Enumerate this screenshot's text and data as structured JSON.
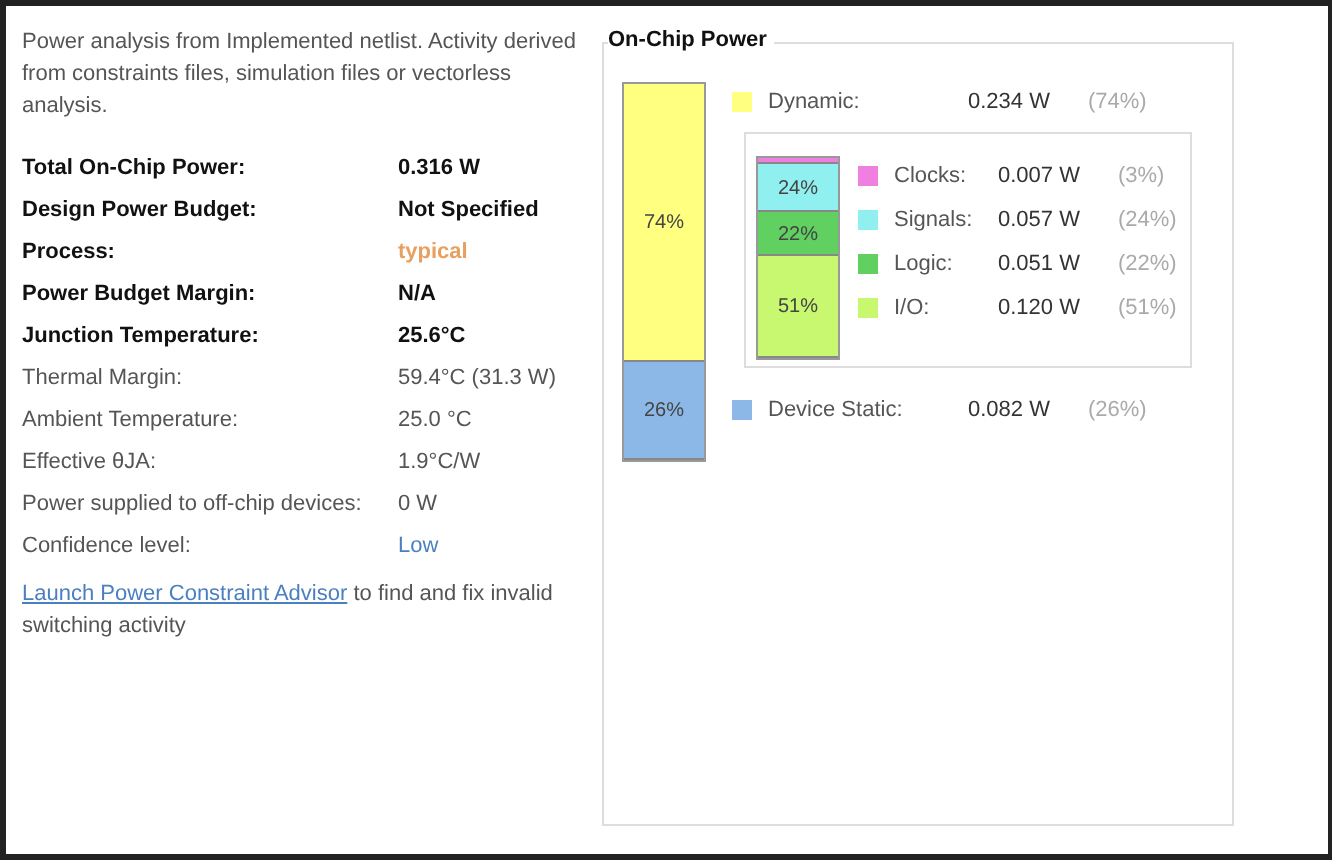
{
  "summary": "Power analysis from Implemented netlist. Activity derived from constraints files, simulation files or vectorless analysis.",
  "metrics": [
    {
      "label": "Total On-Chip Power:",
      "value": "0.316 W",
      "bold": true
    },
    {
      "label": "Design Power Budget:",
      "value": "Not Specified",
      "bold": true
    },
    {
      "label": "Process:",
      "value": "typical",
      "bold": true,
      "color": "#e8a060"
    },
    {
      "label": "Power Budget Margin:",
      "value": "N/A",
      "bold": true
    },
    {
      "label": "Junction Temperature:",
      "value": "25.6°C",
      "bold": true
    },
    {
      "label": "Thermal Margin:",
      "value": "59.4°C (31.3 W)",
      "bold": false
    },
    {
      "label": "Ambient Temperature:",
      "value": "25.0 °C",
      "bold": false
    },
    {
      "label": "Effective θJA:",
      "value": "1.9°C/W",
      "bold": false
    },
    {
      "label": "Power supplied to off-chip devices:",
      "value": "0 W",
      "bold": false
    },
    {
      "label": "Confidence level:",
      "value": "Low",
      "bold": false,
      "color": "#4a7fc0"
    }
  ],
  "advisor": {
    "link": "Launch Power Constraint Advisor",
    "text": "to find and fix invalid switching activity"
  },
  "chart": {
    "title": "On-Chip Power",
    "total_bar": [
      {
        "label": "74%",
        "color": "#ffff80",
        "level": 0.74
      },
      {
        "label": "26%",
        "color": "#8cb8e8",
        "level": 0.26
      }
    ],
    "dynamic": {
      "name": "Dynamic:",
      "value": "0.234 W",
      "pct": "(74%)",
      "color": "#ffff80"
    },
    "dynamic_bar": [
      {
        "color": "#f080e0"
      },
      {
        "label": "24%",
        "color": "#90f0f0"
      },
      {
        "label": "22%",
        "color": "#60d060"
      },
      {
        "label": "51%",
        "color": "#c8f870"
      }
    ],
    "breakdown": [
      {
        "name": "Clocks:",
        "value": "0.007 W",
        "pct": "(3%)",
        "color": "#f080e0"
      },
      {
        "name": "Signals:",
        "value": "0.057 W",
        "pct": "(24%)",
        "color": "#90f0f0"
      },
      {
        "name": "Logic:",
        "value": "0.051 W",
        "pct": "(22%)",
        "color": "#60d060"
      },
      {
        "name": "I/O:",
        "value": "0.120 W",
        "pct": "(51%)",
        "color": "#c8f870"
      }
    ],
    "static": {
      "name": "Device Static:",
      "value": "0.082 W",
      "pct": "(26%)",
      "color": "#8cb8e8"
    }
  }
}
